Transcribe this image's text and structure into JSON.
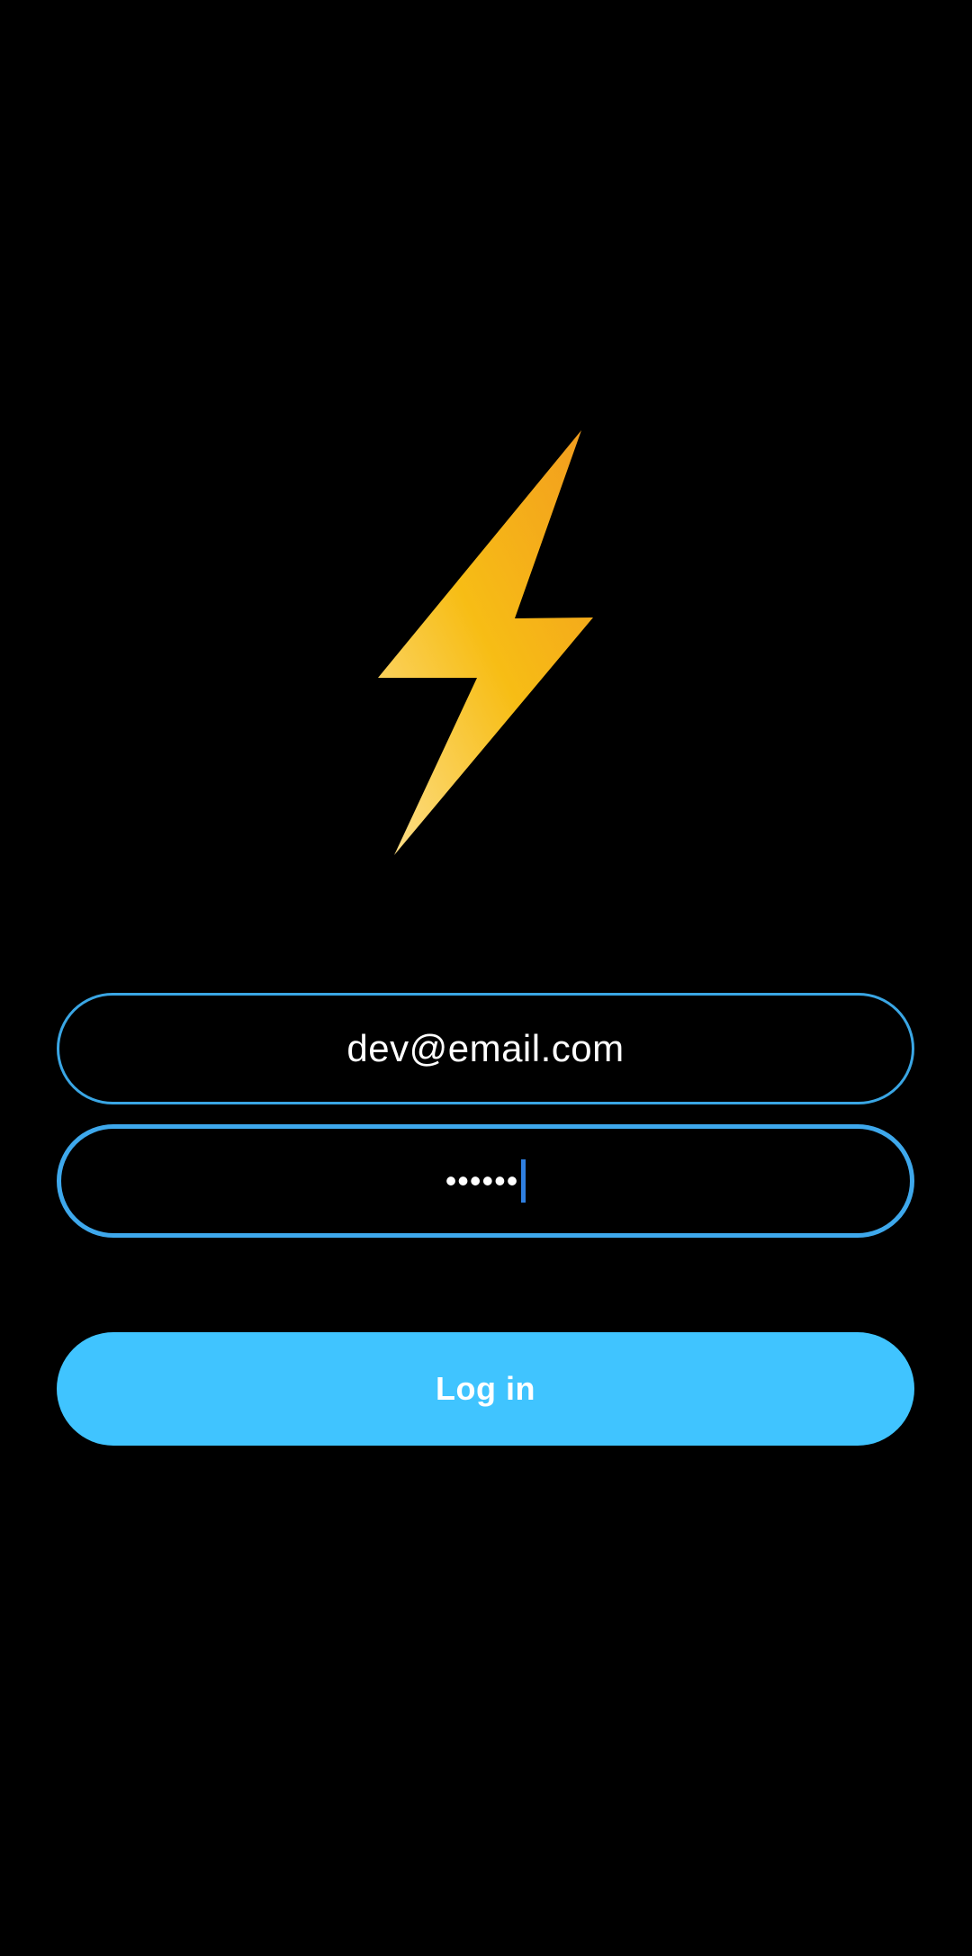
{
  "logo": {
    "icon": "lightning-bolt-icon",
    "colors": [
      "#f5a623",
      "#f8c51a",
      "#fbd56a"
    ]
  },
  "login_form": {
    "email_value": "dev@email.com",
    "password_value": "••••••",
    "submit_label": "Log in"
  },
  "colors": {
    "background": "#000000",
    "field_border": "#3ea8ec",
    "button": "#40c4ff",
    "caret": "#2f7fe0",
    "text": "#ffffff"
  }
}
